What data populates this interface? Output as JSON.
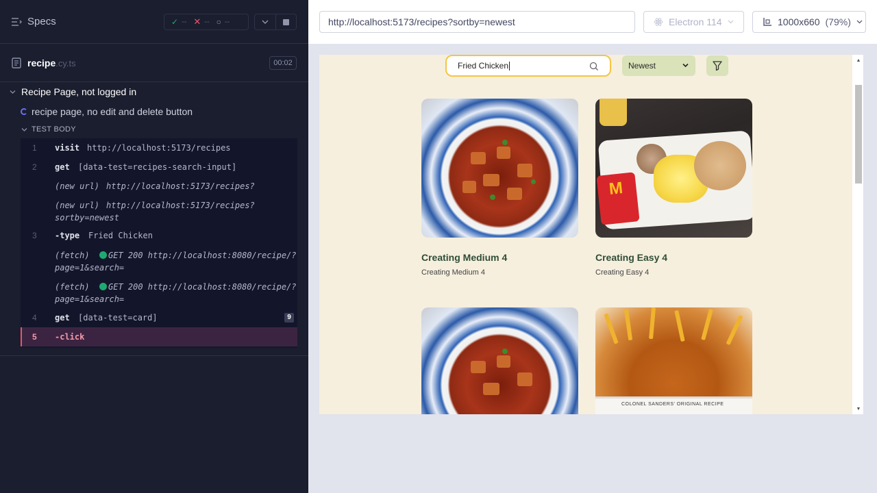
{
  "reporter": {
    "specs_label": "Specs",
    "stats": {
      "passed": "--",
      "failed": "--",
      "pending": "--"
    },
    "spec_file": {
      "name": "recipe",
      "ext": ".cy.ts",
      "duration": "00:02"
    },
    "suite_title": "Recipe Page, not logged in",
    "test_title": "recipe page, no edit and delete button",
    "test_body_label": "TEST BODY",
    "commands": [
      {
        "num": "1",
        "name": "visit",
        "message": "http://localhost:5173/recipes"
      },
      {
        "num": "2",
        "name": "get",
        "message": "[data-test=recipes-search-input]"
      },
      {
        "name": "(new url)",
        "message": "http://localhost:5173/recipes?"
      },
      {
        "name": "(new url)",
        "message": "http://localhost:5173/recipes?\nsortby=newest"
      },
      {
        "num": "3",
        "name": "-type",
        "message": "Fried Chicken"
      },
      {
        "name": "(fetch)",
        "message": "GET 200 http://localhost:8080/recipe/?\npage=1&search="
      },
      {
        "name": "(fetch)",
        "message": "GET 200 http://localhost:8080/recipe/?\npage=1&search="
      },
      {
        "num": "4",
        "name": "get",
        "message": "[data-test=card]",
        "count": "9"
      },
      {
        "num": "5",
        "name": "-click",
        "message": ""
      }
    ]
  },
  "aut": {
    "url": "http://localhost:5173/recipes?sortby=newest",
    "browser": "Electron 114",
    "viewport": "1000x660",
    "viewport_display": "1000x660",
    "scale": "(79%)",
    "search": {
      "value": "Fried Chicken"
    },
    "sort": {
      "selected": "Newest"
    },
    "cards": [
      {
        "title": "Creating Medium 4",
        "subtitle": "Creating Medium 4",
        "image": "mapo-tofu"
      },
      {
        "title": "Creating Easy 4",
        "subtitle": "Creating Easy 4",
        "image": "mcdonalds-breakfast"
      },
      {
        "title": "",
        "subtitle": "",
        "image": "mapo-tofu"
      },
      {
        "title": "",
        "subtitle": "",
        "image": "fried-chicken"
      }
    ],
    "bucket_text": "COLONEL SANDERS' ORIGINAL RECIPE"
  },
  "colors": {
    "reporter_bg": "#1b1e2e",
    "command_bg": "#13162a",
    "active_command": "#3b2442",
    "pass": "#1fa971",
    "fail": "#e45770",
    "app_bg": "#f6efde",
    "search_border": "#f5c542",
    "sort_bg": "#d9e2b8",
    "card_title": "#2f4d36"
  }
}
